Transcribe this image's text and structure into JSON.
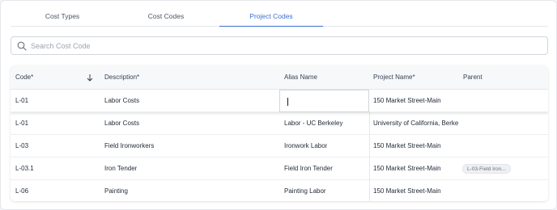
{
  "tabs": [
    {
      "label": "Cost Types"
    },
    {
      "label": "Cost Codes"
    },
    {
      "label": "Project Codes",
      "active": true
    }
  ],
  "search": {
    "placeholder": "Search Cost Code",
    "value": ""
  },
  "accent_color": "#3b6fd4",
  "icons": {
    "search": "search-icon",
    "sort": "arrow-down-icon"
  },
  "columns": [
    {
      "label": "Code*",
      "sort": "descending"
    },
    {
      "label": "Description*"
    },
    {
      "label": "Alias Name"
    },
    {
      "label": "Project Name*"
    },
    {
      "label": "Parent"
    }
  ],
  "rows": [
    {
      "code": "L-01",
      "description": "Labor Costs",
      "alias": "",
      "project": "150 Market Street-Main",
      "parent": "",
      "editing": true
    },
    {
      "code": "L-01",
      "description": "Labor Costs",
      "alias": "Labor - UC Berkeley",
      "project": "University of California, Berke",
      "parent": ""
    },
    {
      "code": "L-03",
      "description": "Field Ironworkers",
      "alias": "Ironwork Labor",
      "project": "150 Market Street-Main",
      "parent": ""
    },
    {
      "code": "L-03.1",
      "description": "Iron Tender",
      "alias": "Field Iron Tender",
      "project": "150 Market Street-Main",
      "parent": "L-03-Field Iron..."
    },
    {
      "code": "L-06",
      "description": "Painting",
      "alias": "Painting Labor",
      "project": "150 Market Street-Main",
      "parent": ""
    }
  ]
}
